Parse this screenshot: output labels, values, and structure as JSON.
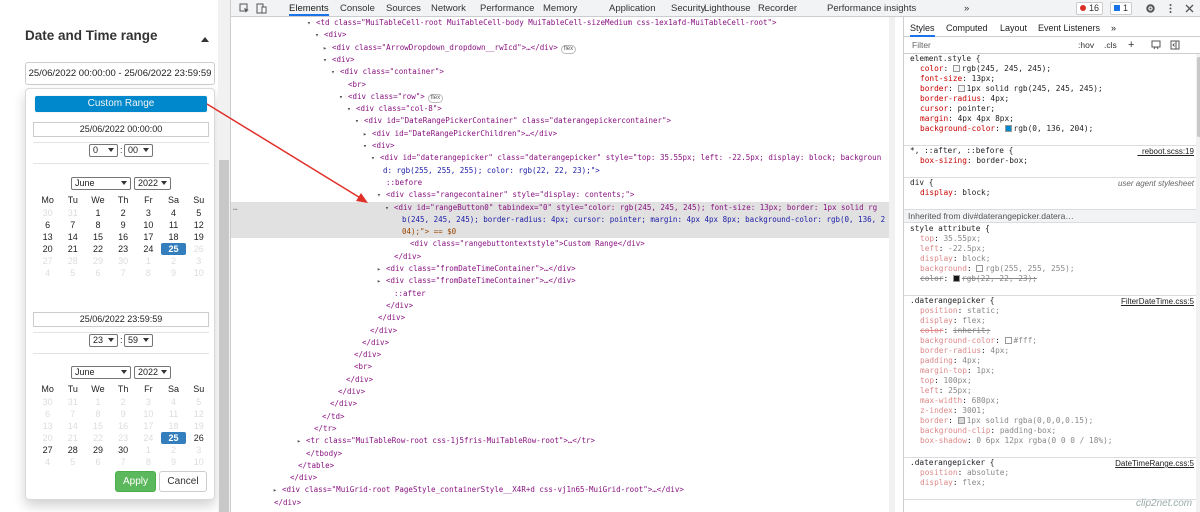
{
  "app": {
    "filter_title": "Date and Time range",
    "range_value": "25/06/2022 00:00:00 - 25/06/2022 23:59:59",
    "custom_range_label": "Custom Range",
    "from": {
      "datetime": "25/06/2022 00:00:00",
      "hour": "0",
      "minute": "00",
      "month": "June",
      "year": "2022"
    },
    "to": {
      "datetime": "25/06/2022 23:59:59",
      "hour": "23",
      "minute": "59",
      "month": "June",
      "year": "2022"
    },
    "time_separator": ":",
    "weekdays": [
      "Mo",
      "Tu",
      "We",
      "Th",
      "Fr",
      "Sa",
      "Su"
    ],
    "from_calendar": [
      [
        "30",
        "31",
        "1",
        "2",
        "3",
        "4",
        "5"
      ],
      [
        "6",
        "7",
        "8",
        "9",
        "10",
        "11",
        "12"
      ],
      [
        "13",
        "14",
        "15",
        "16",
        "17",
        "18",
        "19"
      ],
      [
        "20",
        "21",
        "22",
        "23",
        "24",
        "25",
        "26"
      ],
      [
        "27",
        "28",
        "29",
        "30",
        "1",
        "2",
        "3"
      ],
      [
        "4",
        "5",
        "6",
        "7",
        "8",
        "9",
        "10"
      ]
    ],
    "from_calendar_state": [
      [
        "off",
        "off",
        "on",
        "on",
        "on",
        "on",
        "on"
      ],
      [
        "on",
        "on",
        "on",
        "on",
        "on",
        "on",
        "on"
      ],
      [
        "on",
        "on",
        "on",
        "on",
        "on",
        "on",
        "on"
      ],
      [
        "on",
        "on",
        "on",
        "on",
        "on",
        "sel",
        "off"
      ],
      [
        "off",
        "off",
        "off",
        "off",
        "off",
        "off",
        "off"
      ],
      [
        "off",
        "off",
        "off",
        "off",
        "off",
        "off",
        "off"
      ]
    ],
    "to_calendar": [
      [
        "30",
        "31",
        "1",
        "2",
        "3",
        "4",
        "5"
      ],
      [
        "6",
        "7",
        "8",
        "9",
        "10",
        "11",
        "12"
      ],
      [
        "13",
        "14",
        "15",
        "16",
        "17",
        "18",
        "19"
      ],
      [
        "20",
        "21",
        "22",
        "23",
        "24",
        "25",
        "26"
      ],
      [
        "27",
        "28",
        "29",
        "30",
        "1",
        "2",
        "3"
      ],
      [
        "4",
        "5",
        "6",
        "7",
        "8",
        "9",
        "10"
      ]
    ],
    "to_calendar_state": [
      [
        "off",
        "off",
        "off",
        "off",
        "off",
        "off",
        "off"
      ],
      [
        "off",
        "off",
        "off",
        "off",
        "off",
        "off",
        "off"
      ],
      [
        "off",
        "off",
        "off",
        "off",
        "off",
        "off",
        "off"
      ],
      [
        "off",
        "off",
        "off",
        "off",
        "off",
        "sel",
        "on"
      ],
      [
        "on",
        "on",
        "on",
        "on",
        "off",
        "off",
        "off"
      ],
      [
        "off",
        "off",
        "off",
        "off",
        "off",
        "off",
        "off"
      ]
    ],
    "apply_label": "Apply",
    "cancel_label": "Cancel",
    "colors": {
      "custom_range_bg": "#0088cc",
      "selected_day": "#357ebd",
      "apply_bg": "#5cb85c"
    }
  },
  "devtools": {
    "tabs": [
      "Elements",
      "Console",
      "Sources",
      "Network",
      "Performance",
      "Memory",
      "Application",
      "Security",
      "Lighthouse",
      "Recorder",
      "Performance insights"
    ],
    "more_tabs": "»",
    "error_count": "16",
    "message_count": "1",
    "tree_lines": [
      "<td class=\"MuiTableCell-root MuiTableCell-body MuiTableCell-sizeMedium css-1ex1afd-MuiTableCell-root\">",
      "<div>",
      "<div class=\"ArrowDropdown_dropdown__rwIcd\">…</div>",
      "<div>",
      "<div class=\"container\">",
      "<br>",
      "<div class=\"row\">",
      "<div class=\"col-8\">",
      "<div id=\"DateRangePickerContainer\" class=\"daterangepickercontainer\">",
      "<div id=\"DateRangePickerChildren\">…</div>",
      "<div>",
      "<div id=\"daterangepicker\" class=\"daterangepicker\" style=\"top: 35.55px; left: -22.5px; display: block; backgroun",
      "d: rgb(255, 255, 255); color: rgb(22, 22, 23);\">",
      "::before",
      "<div class=\"rangecontainer\" style=\"display: contents;\">",
      "<div id=\"rangeButton0\" tabindex=\"0\" style=\"color: rgb(245, 245, 245); font-size: 13px; border: 1px solid rg",
      "b(245, 245, 245); border-radius: 4px; cursor: pointer; margin: 4px 4px 8px; background-color: rgb(0, 136, 2",
      "04);\"> == $0",
      "<div class=\"rangebuttontextstyle\">Custom Range</div>",
      "</div>",
      "<div class=\"fromDateTimeContainer\">…</div>",
      "<div class=\"fromDateTimeContainer\">…</div>",
      "::after",
      "</div>",
      "</div>",
      "</div>",
      "</div>",
      "</div>",
      "<br>",
      "</div>",
      "</div>",
      "</div>",
      "</td>",
      "</tr>",
      "<tr class=\"MuiTableRow-root css-1j5fris-MuiTableRow-root\">…</tr>",
      "</tbody>",
      "</table>",
      "</div>",
      "<div class=\"MuiGrid-root PageStyle_containerStyle__X4R+d css-vj1n65-MuiGrid-root\">…</div>",
      "</div>"
    ],
    "pills": {
      "flex": "flex"
    },
    "gutter_dots": "…",
    "styles_tabs": [
      "Styles",
      "Computed",
      "Layout",
      "Event Listeners",
      "»"
    ],
    "filter_placeholder": "Filter",
    "filter_tools": [
      ":hov",
      ".cls",
      "+"
    ],
    "rules": {
      "element_style": {
        "selector": "element.style {",
        "props": [
          [
            "color",
            "rgb(245, 245, 245);"
          ],
          [
            "font-size",
            "13px;"
          ],
          [
            "border",
            "1px solid rgb(245, 245, 245);"
          ],
          [
            "border-radius",
            "4px;"
          ],
          [
            "cursor",
            "pointer;"
          ],
          [
            "margin",
            "4px 4px 8px;"
          ],
          [
            "background-color",
            "rgb(0, 136, 204);"
          ]
        ]
      },
      "reboot": {
        "selector": "*, ::after, ::before {",
        "source": "_reboot.scss:19",
        "props": [
          [
            "box-sizing",
            "border-box;"
          ]
        ]
      },
      "ua_div": {
        "selector": "div {",
        "source": "user agent stylesheet",
        "props": [
          [
            "display",
            "block;"
          ]
        ]
      },
      "inherited_label": "Inherited from div#daterangepicker.datera…",
      "style_attr": {
        "selector": "style attribute {",
        "props": [
          [
            "top",
            "35.55px;"
          ],
          [
            "left",
            "-22.5px;"
          ],
          [
            "display",
            "block;"
          ],
          [
            "background",
            "rgb(255, 255, 255);"
          ],
          [
            "color",
            "rgb(22, 22, 23);"
          ]
        ]
      },
      "filter_dt": {
        "selector": ".daterangepicker {",
        "source": "FilterDateTime.css:5",
        "props": [
          [
            "position",
            "static;"
          ],
          [
            "display",
            "flex;"
          ],
          [
            "color",
            "inherit;"
          ],
          [
            "background-color",
            "#fff;"
          ],
          [
            "border-radius",
            "4px;"
          ],
          [
            "padding",
            "4px;"
          ],
          [
            "margin-top",
            "1px;"
          ],
          [
            "top",
            "100px;"
          ],
          [
            "left",
            "25px;"
          ],
          [
            "max-width",
            "680px;"
          ],
          [
            "z-index",
            "3001;"
          ],
          [
            "border",
            "1px solid rgba(0,0,0,0.15);"
          ],
          [
            "background-clip",
            "padding-box;"
          ],
          [
            "box-shadow",
            "0 6px 12px rgba(0 0 0 / 18%);"
          ]
        ]
      },
      "dtrange": {
        "selector": ".daterangepicker {",
        "source": "DateTimeRange.css:5",
        "props": [
          [
            "position",
            "absolute;"
          ],
          [
            "display",
            "flex;"
          ]
        ]
      }
    },
    "watermark": "clip2net.com"
  }
}
